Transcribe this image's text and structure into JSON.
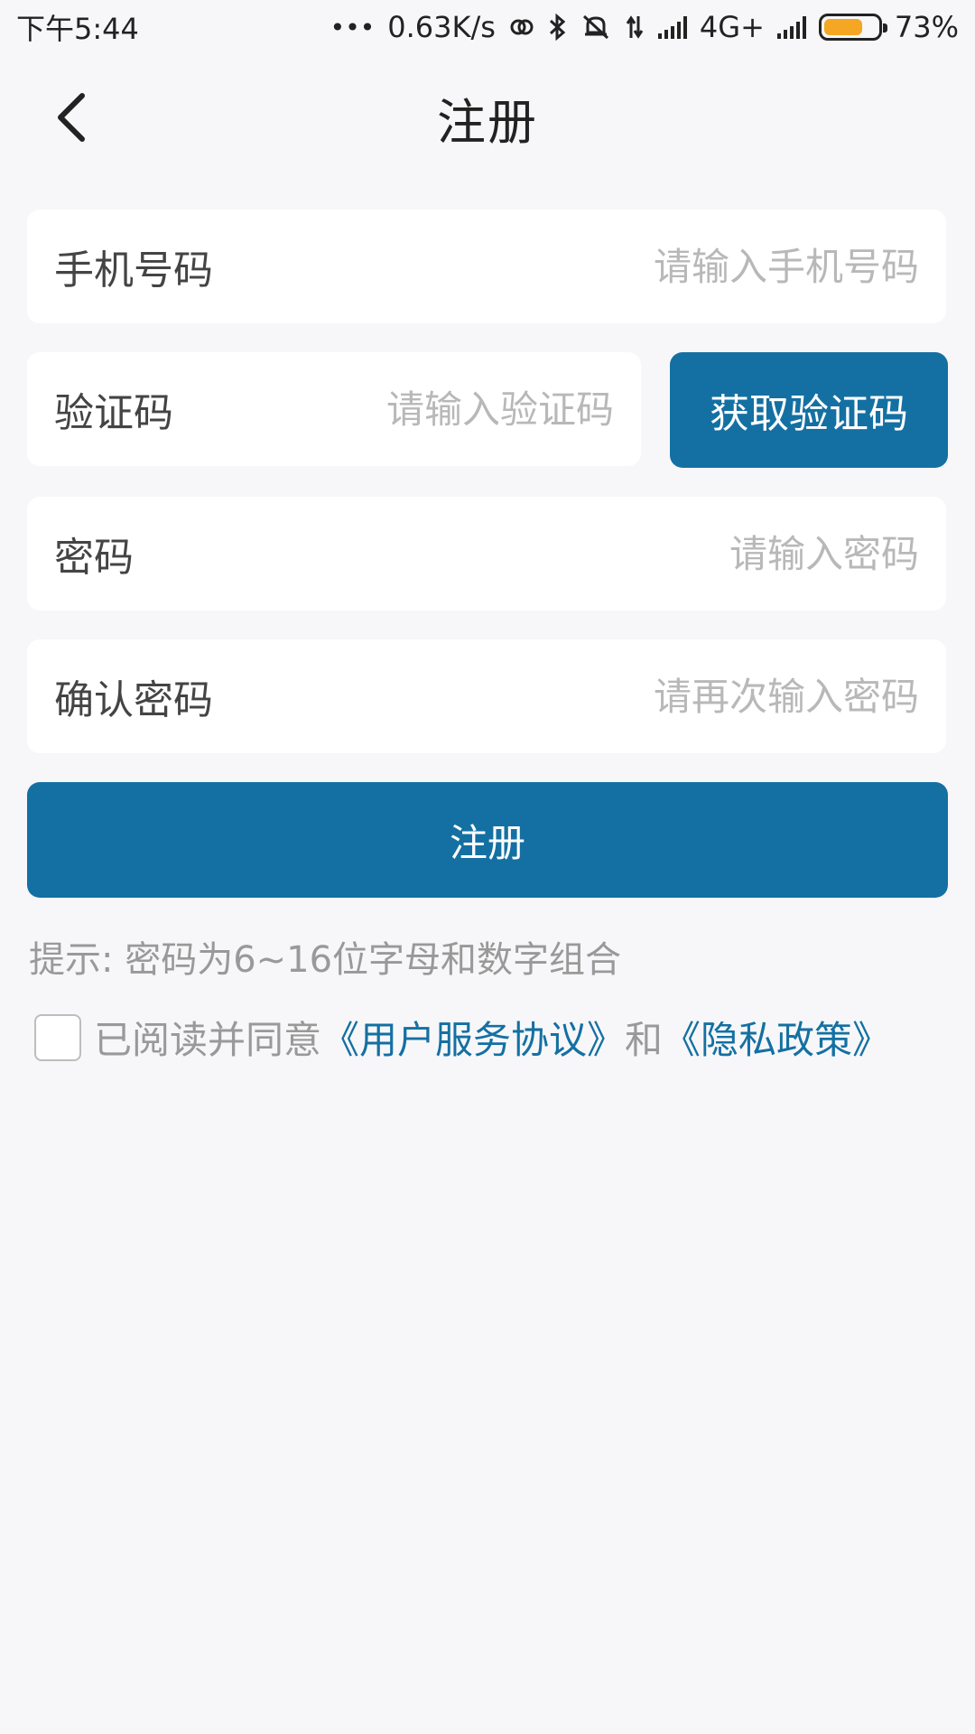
{
  "status_bar": {
    "time": "下午5:44",
    "more": "•••",
    "network_speed": "0.63K/s",
    "network_type": "4G+",
    "battery_percent": "73%",
    "battery_level": 0.73,
    "battery_color": "#f5a623",
    "icons": [
      "link-icon",
      "bluetooth-icon",
      "mute-icon",
      "data-transfer-icon",
      "signal-icon",
      "signal-icon-2",
      "battery-icon"
    ]
  },
  "header": {
    "title": "注册",
    "back_icon": "chevron-left-icon"
  },
  "form": {
    "phone": {
      "label": "手机号码",
      "placeholder": "请输入手机号码",
      "value": ""
    },
    "code": {
      "label": "验证码",
      "placeholder": "请输入验证码",
      "value": "",
      "button_label": "获取验证码"
    },
    "password": {
      "label": "密码",
      "placeholder": "请输入密码",
      "value": ""
    },
    "confirm_password": {
      "label": "确认密码",
      "placeholder": "请再次输入密码",
      "value": ""
    },
    "submit_label": "注册",
    "hint": "提示: 密码为6~16位字母和数字组合"
  },
  "agreement": {
    "checked": false,
    "prefix": "已阅读并同意",
    "user_agreement": "《用户服务协议》",
    "conjunction": "和",
    "privacy_policy": "《隐私政策》"
  },
  "colors": {
    "accent": "#1470a2",
    "background": "#f7f7f9",
    "placeholder": "#b8b8b8",
    "hint": "#999999"
  }
}
